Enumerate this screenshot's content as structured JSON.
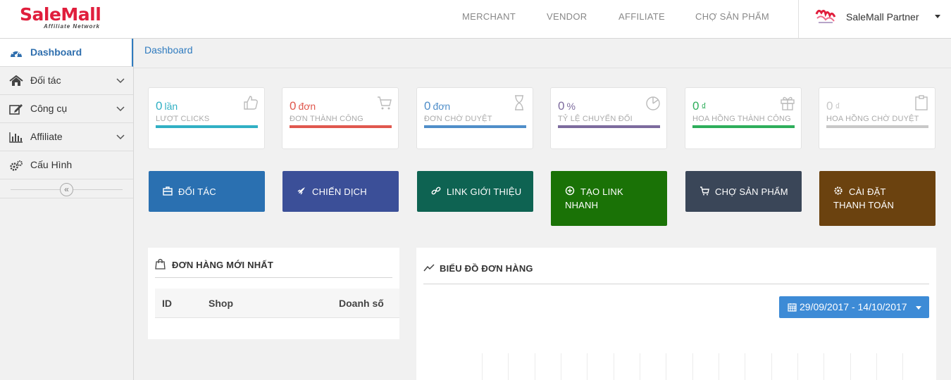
{
  "app": {
    "brand": "SaleMall",
    "brand_tagline": "Affiliate Network",
    "accent": "#2f7bbf",
    "brand_color": "#e01e3c"
  },
  "topnav": [
    "MERCHANT",
    "VENDOR",
    "AFFILIATE",
    "CHỢ SẢN PHẨM"
  ],
  "user": {
    "name": "SaleMall Partner"
  },
  "sidebar": {
    "items": [
      {
        "label": "Dashboard",
        "icon": "dashboard-icon",
        "active": true,
        "expandable": false
      },
      {
        "label": "Đối tác",
        "icon": "home-icon",
        "active": false,
        "expandable": true
      },
      {
        "label": "Công cụ",
        "icon": "edit-icon",
        "active": false,
        "expandable": true
      },
      {
        "label": "Affiliate",
        "icon": "bar-chart-icon",
        "active": false,
        "expandable": true
      },
      {
        "label": "Cấu Hình",
        "icon": "gears-icon",
        "active": false,
        "expandable": false
      }
    ],
    "collapse_glyph": "«"
  },
  "breadcrumb": "Dashboard",
  "stats": [
    {
      "value": "0",
      "unit": "lần",
      "label": "LƯỢT CLICKS",
      "color": "#31b0c4",
      "icon": "thumbs-up-icon"
    },
    {
      "value": "0",
      "unit": "đơn",
      "label": "ĐƠN THÀNH CÔNG",
      "color": "#e0584e",
      "icon": "cart-icon"
    },
    {
      "value": "0",
      "unit": "đơn",
      "label": "ĐƠN CHỜ DUYỆT",
      "color": "#4f8ec9",
      "icon": "hourglass-icon"
    },
    {
      "value": "0",
      "unit": "%",
      "label": "TỶ LỆ CHUYỂN ĐỔI",
      "color": "#7d6b9e",
      "icon": "pie-chart-icon"
    },
    {
      "value": "0",
      "unit": "₫",
      "label": "HOA HỒNG THÀNH CÔNG",
      "color": "#2eae5b",
      "icon": "gift-icon"
    },
    {
      "value": "0",
      "unit": "₫",
      "label": "HOA HỒNG CHỜ DUYỆT",
      "color": "#c8c8c8",
      "icon": "clipboard-icon"
    }
  ],
  "actions": [
    {
      "label": "ĐỐI TÁC",
      "color": "#2a70b1",
      "icon": "briefcase-icon"
    },
    {
      "label": "CHIẾN DỊCH",
      "color": "#3b4f98",
      "icon": "rocket-icon"
    },
    {
      "label": "LINK GIỚI THIỆU",
      "color": "#0e6352",
      "icon": "link-icon"
    },
    {
      "label": "TẠO LINK NHANH",
      "color": "#1a7206",
      "icon": "plus-circle-icon"
    },
    {
      "label": "CHỢ SẢN PHẨM",
      "color": "#3a4658",
      "icon": "cart-icon"
    },
    {
      "label": "CÀI ĐẶT THANH TOÁN",
      "color": "#6b420f",
      "icon": "cog-icon"
    }
  ],
  "orders_panel": {
    "title": "ĐƠN HÀNG MỚI NHẤT",
    "icon": "shopping-bag-icon",
    "columns": [
      "ID",
      "Shop",
      "Doanh số"
    ]
  },
  "chart_panel": {
    "title": "BIỂU ĐỒ ĐƠN HÀNG",
    "icon": "line-chart-icon",
    "date_range": "29/09/2017 - 14/10/2017"
  }
}
